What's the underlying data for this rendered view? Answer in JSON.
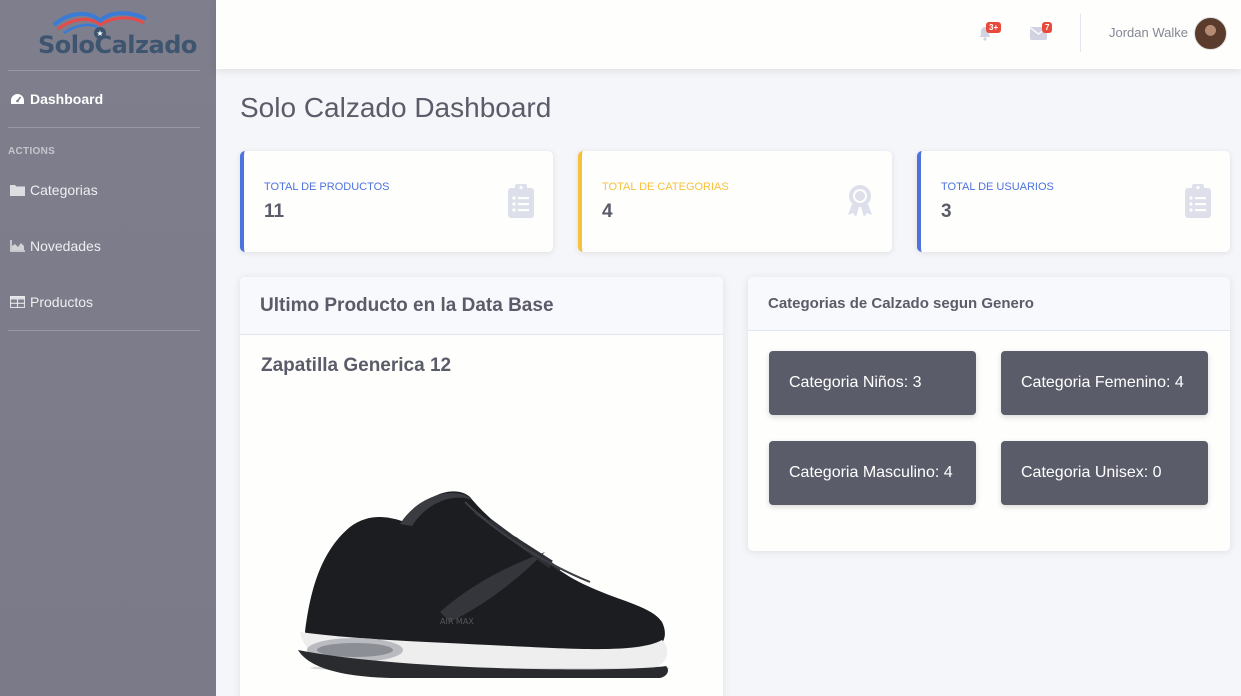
{
  "brand": {
    "name": "SoloCalzado"
  },
  "sidebar": {
    "dashboard": "Dashboard",
    "heading": "ACTIONS",
    "items": [
      {
        "label": "Categorias",
        "icon": "folder-icon"
      },
      {
        "label": "Novedades",
        "icon": "area-chart-icon"
      },
      {
        "label": "Productos",
        "icon": "table-icon"
      }
    ]
  },
  "topbar": {
    "alerts_badge": "3+",
    "messages_badge": "7",
    "user_name": "Jordan Walke"
  },
  "page": {
    "title": "Solo Calzado Dashboard"
  },
  "stats": [
    {
      "label": "TOTAL DE PRODUCTOS",
      "value": "11",
      "color": "#4e73df",
      "icon": "clipboard-list-icon"
    },
    {
      "label": "TOTAL DE CATEGORIAS",
      "value": "4",
      "color": "#f6c23e",
      "icon": "award-icon"
    },
    {
      "label": "TOTAL DE USUARIOS",
      "value": "3",
      "color": "#4e73df",
      "icon": "clipboard-list-icon"
    }
  ],
  "last_product": {
    "header": "Ultimo Producto en la Data Base",
    "name": "Zapatilla Generica 12",
    "image": "sneaker-image"
  },
  "categories": {
    "header": "Categorias de Calzado segun Genero",
    "items": [
      {
        "label": "Categoria Niños: 3"
      },
      {
        "label": "Categoria Femenino: 4"
      },
      {
        "label": "Categoria Masculino: 4"
      },
      {
        "label": "Categoria Unisex: 0"
      }
    ]
  },
  "colors": {
    "primary": "#4e73df",
    "warning": "#f6c23e",
    "danger": "#e74a3b",
    "dark": "#5a5c69"
  }
}
